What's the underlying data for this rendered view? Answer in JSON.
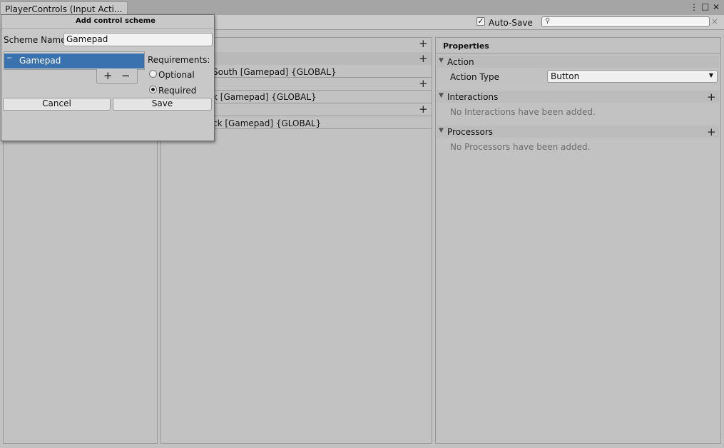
{
  "window": {
    "tab_title": "PlayerControls (Input Acti...",
    "menu_icon": "⋮",
    "maximize_icon": "□",
    "close_icon": "✕"
  },
  "toolbar": {
    "auto_save_checked": true,
    "auto_save_label": "Auto-Save",
    "search_value": "",
    "search_clear": "×"
  },
  "actions_panel": {
    "add_icon": "+",
    "bindings": [
      "South [Gamepad] {GLOBAL}",
      "k [Gamepad] {GLOBAL}",
      "ck [Gamepad] {GLOBAL}"
    ]
  },
  "properties": {
    "title": "Properties",
    "action_section": "Action",
    "action_type_label": "Action Type",
    "action_type_value": "Button",
    "interactions_section": "Interactions",
    "interactions_empty": "No Interactions have been added.",
    "processors_section": "Processors",
    "processors_empty": "No Processors have been added."
  },
  "dialog": {
    "title": "Add control scheme",
    "scheme_name_label": "Scheme Name",
    "scheme_name_value": "Gamepad",
    "devices": [
      "Gamepad"
    ],
    "add_label": "+",
    "remove_label": "−",
    "requirements_label": "Requirements:",
    "optional_label": "Optional",
    "required_label": "Required",
    "selected_requirement": "Required",
    "cancel_label": "Cancel",
    "save_label": "Save"
  },
  "colors": {
    "selection": "#3a72b0",
    "background": "#c2c2c2"
  }
}
